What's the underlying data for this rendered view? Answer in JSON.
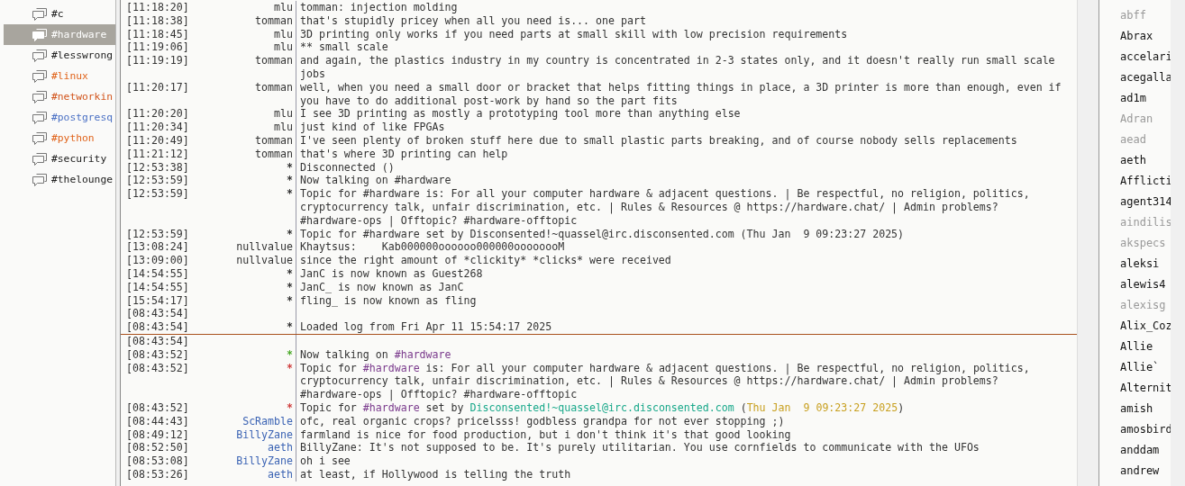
{
  "channels": [
    {
      "name": "#c",
      "selected": false,
      "color": "#202020"
    },
    {
      "name": "#hardware",
      "selected": true,
      "color": "#ffffff"
    },
    {
      "name": "#lesswrong",
      "selected": false,
      "color": "#202020"
    },
    {
      "name": "#linux",
      "selected": false,
      "color": "#e0641c"
    },
    {
      "name": "#networkin",
      "selected": false,
      "color": "#d2561e"
    },
    {
      "name": "#postgresq",
      "selected": false,
      "color": "#4a70c4"
    },
    {
      "name": "#python",
      "selected": false,
      "color": "#e0641c"
    },
    {
      "name": "#security",
      "selected": false,
      "color": "#202020"
    },
    {
      "name": "#thelounge",
      "selected": false,
      "color": "#202020"
    }
  ],
  "messages": [
    {
      "kind": "message",
      "time": "[11:18:20]",
      "nick": "mlu",
      "color": "#333333",
      "parts": [
        {
          "text": "tomman: injection molding"
        }
      ]
    },
    {
      "kind": "message",
      "time": "[11:18:38]",
      "nick": "tomman",
      "color": "#333333",
      "parts": [
        {
          "text": "that's stupidly pricey when all you need is... one part"
        }
      ]
    },
    {
      "kind": "message",
      "time": "[11:18:45]",
      "nick": "mlu",
      "color": "#333333",
      "parts": [
        {
          "text": "3D printing only works if you need parts at small skill with low precision requirements"
        }
      ]
    },
    {
      "kind": "message",
      "time": "[11:19:06]",
      "nick": "mlu",
      "color": "#333333",
      "parts": [
        {
          "text": "** small scale"
        }
      ]
    },
    {
      "kind": "message",
      "time": "[11:19:19]",
      "nick": "tomman",
      "color": "#333333",
      "parts": [
        {
          "text": "and again, the plastics industry in my country is concentrated in 2-3 states only, and it doesn't really run small scale jobs"
        }
      ]
    },
    {
      "kind": "message",
      "time": "[11:20:17]",
      "nick": "tomman",
      "color": "#333333",
      "parts": [
        {
          "text": "well, when you need a small door or bracket that helps fitting things in place, a 3D printer is more than enough, even if you have to do additional post-work by hand so the part fits"
        }
      ]
    },
    {
      "kind": "message",
      "time": "[11:20:20]",
      "nick": "mlu",
      "color": "#333333",
      "parts": [
        {
          "text": "I see 3D printing as mostly a prototyping tool more than anything else"
        }
      ]
    },
    {
      "kind": "message",
      "time": "[11:20:34]",
      "nick": "mlu",
      "color": "#333333",
      "parts": [
        {
          "text": "just kind of like FPGAs"
        }
      ]
    },
    {
      "kind": "message",
      "time": "[11:20:49]",
      "nick": "tomman",
      "color": "#333333",
      "parts": [
        {
          "text": "I've seen plenty of broken stuff here due to small plastic parts breaking, and of course nobody sells replacements"
        }
      ]
    },
    {
      "kind": "message",
      "time": "[11:21:12]",
      "nick": "tomman",
      "color": "#333333",
      "parts": [
        {
          "text": "that's where 3D printing can help"
        }
      ]
    },
    {
      "kind": "event",
      "time": "[12:53:38]",
      "nick": "*",
      "parts": [
        {
          "text": "Disconnected ()"
        }
      ]
    },
    {
      "kind": "event",
      "time": "[12:53:59]",
      "nick": "*",
      "parts": [
        {
          "text": "Now talking on #hardware"
        }
      ]
    },
    {
      "kind": "event",
      "time": "[12:53:59]",
      "nick": "*",
      "parts": [
        {
          "text": "Topic for #hardware is: For all your computer hardware & adjacent questions. | Be respectful, no religion, politics, cryptocurrency talk, unfair discrimination, etc. | Rules & Resources @ https://hardware.chat/ | Admin problems? #hardware-ops | Offtopic? #hardware-offtopic"
        }
      ]
    },
    {
      "kind": "event",
      "time": "[12:53:59]",
      "nick": "*",
      "parts": [
        {
          "text": "Topic for #hardware set by Disconsented!~quassel@irc.disconsented.com (Thu Jan  9 09:23:27 2025)"
        }
      ]
    },
    {
      "kind": "message",
      "time": "[13:08:24]",
      "nick": "nullvalue",
      "color": "#333333",
      "parts": [
        {
          "text": "Khaytsus:    Kab000000oooooo000000oooooooM"
        }
      ]
    },
    {
      "kind": "message",
      "time": "[13:09:00]",
      "nick": "nullvalue",
      "color": "#333333",
      "parts": [
        {
          "text": "since the right amount of *clickity* *clicks* were received"
        }
      ]
    },
    {
      "kind": "event",
      "time": "[14:54:55]",
      "nick": "*",
      "parts": [
        {
          "text": "JanC is now known as Guest268"
        }
      ]
    },
    {
      "kind": "event",
      "time": "[14:54:55]",
      "nick": "*",
      "parts": [
        {
          "text": "JanC_ is now known as JanC"
        }
      ]
    },
    {
      "kind": "event",
      "time": "[15:54:17]",
      "nick": "*",
      "parts": [
        {
          "text": "fling_ is now known as fling"
        }
      ]
    },
    {
      "kind": "blank",
      "time": "[08:43:54]"
    },
    {
      "kind": "event",
      "time": "[08:43:54]",
      "nick": "*",
      "parts": [
        {
          "text": "Loaded log from Fri Apr 11 15:54:17 2025"
        }
      ]
    },
    {
      "kind": "marker"
    },
    {
      "kind": "blank",
      "time": "[08:43:54]"
    },
    {
      "kind": "event",
      "time": "[08:43:52]",
      "nick": "*",
      "color": "#4caa2a",
      "parts": [
        {
          "text": "Now talking on "
        },
        {
          "text": "#hardware",
          "color": "#7a3a8c"
        }
      ]
    },
    {
      "kind": "event",
      "time": "[08:43:52]",
      "nick": "*",
      "color": "#d04040",
      "parts": [
        {
          "text": "Topic for "
        },
        {
          "text": "#hardware",
          "color": "#7a3a8c"
        },
        {
          "text": " is: For all your computer hardware & adjacent questions. | Be respectful, no religion, politics, cryptocurrency talk, unfair discrimination, etc. | Rules & Resources @ https://hardware.chat/ | Admin problems? #hardware-ops | Offtopic? #hardware-offtopic"
        }
      ]
    },
    {
      "kind": "event",
      "time": "[08:43:52]",
      "nick": "*",
      "color": "#d04040",
      "parts": [
        {
          "text": "Topic for "
        },
        {
          "text": "#hardware",
          "color": "#7a3a8c"
        },
        {
          "text": " set by "
        },
        {
          "text": "Disconsented!~quassel@irc.disconsented.com",
          "color": "#18a88a"
        },
        {
          "text": " ("
        },
        {
          "text": "Thu Jan  9 09:23:27 2025",
          "color": "#c8a020"
        },
        {
          "text": ")"
        }
      ]
    },
    {
      "kind": "message",
      "time": "[08:44:43]",
      "nick": "ScRamble",
      "color": "#3c64b4",
      "parts": [
        {
          "text": "ofc, real organic crops? pricelsss! godbless grandpa for not ever stopping ;)"
        }
      ]
    },
    {
      "kind": "message",
      "time": "[08:49:12]",
      "nick": "BillyZane",
      "color": "#3c64b4",
      "parts": [
        {
          "text": "farmland is nice for food production, but i don't think it's that good looking"
        }
      ]
    },
    {
      "kind": "message",
      "time": "[08:52:50]",
      "nick": "aeth",
      "color": "#3c64b4",
      "parts": [
        {
          "text": "BillyZane: It's not supposed to be. It's purely utilitarian. You use cornfields to communicate with the UFOs"
        }
      ]
    },
    {
      "kind": "message",
      "time": "[08:53:08]",
      "nick": "BillyZane",
      "color": "#3c64b4",
      "parts": [
        {
          "text": "oh i see"
        }
      ]
    },
    {
      "kind": "message",
      "time": "[08:53:26]",
      "nick": "aeth",
      "color": "#3c64b4",
      "parts": [
        {
          "text": "at least, if Hollywood is telling the truth"
        }
      ]
    }
  ],
  "users": [
    {
      "nick": "abff",
      "away": true
    },
    {
      "nick": "Abrax",
      "away": false
    },
    {
      "nick": "accelari",
      "away": false
    },
    {
      "nick": "acegalla",
      "away": false
    },
    {
      "nick": "ad1m",
      "away": false
    },
    {
      "nick": "Adran",
      "away": true
    },
    {
      "nick": "aead",
      "away": true
    },
    {
      "nick": "aeth",
      "away": false
    },
    {
      "nick": "Afflicti",
      "away": false
    },
    {
      "nick": "agent314",
      "away": false
    },
    {
      "nick": "aindilis",
      "away": true
    },
    {
      "nick": "akspecs",
      "away": true
    },
    {
      "nick": "aleksi",
      "away": false
    },
    {
      "nick": "alewis4",
      "away": false
    },
    {
      "nick": "alexisg",
      "away": true
    },
    {
      "nick": "Alix_Coz",
      "away": false
    },
    {
      "nick": "Allie",
      "away": false
    },
    {
      "nick": "Allie`",
      "away": false
    },
    {
      "nick": "Alternit",
      "away": false
    },
    {
      "nick": "amish",
      "away": false
    },
    {
      "nick": "amosbird",
      "away": false
    },
    {
      "nick": "anddam",
      "away": false
    },
    {
      "nick": "andrew",
      "away": false
    }
  ]
}
